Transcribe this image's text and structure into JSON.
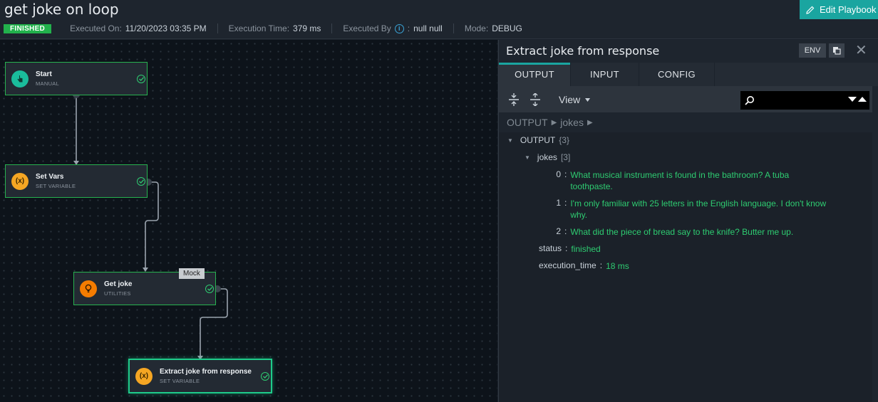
{
  "header": {
    "title": "get joke on loop",
    "edit_label": "Edit Playbook",
    "status": "FINISHED",
    "executed_on_label": "Executed On:",
    "executed_on": "11/20/2023 03:35 PM",
    "execution_time_label": "Execution Time:",
    "execution_time": "379 ms",
    "executed_by_label": "Executed By",
    "executed_by": "null null",
    "mode_label": "Mode:",
    "mode": "DEBUG"
  },
  "nodes": [
    {
      "name": "Start",
      "type": "MANUAL",
      "icon": "hand-pointer-icon"
    },
    {
      "name": "Set Vars",
      "type": "SET VARIABLE",
      "icon": "variable-icon"
    },
    {
      "name": "Get joke",
      "type": "UTILITIES",
      "icon": "lightbulb-icon",
      "tag": "Mock"
    },
    {
      "name": "Extract joke from response",
      "type": "SET VARIABLE",
      "icon": "variable-icon"
    }
  ],
  "variable_glyph": "(x)",
  "panel": {
    "title": "Extract joke from response",
    "env_label": "ENV",
    "close_glyph": "✕",
    "tabs": [
      "OUTPUT",
      "INPUT",
      "CONFIG"
    ],
    "view_label": "View",
    "breadcrumb": [
      "OUTPUT",
      "jokes"
    ],
    "breadcrumb_sep": "▶",
    "tree": {
      "root_label": "OUTPUT",
      "root_count": "{3}",
      "jokes_label": "jokes",
      "jokes_count": "[3]",
      "jokes": [
        {
          "index": "0",
          "line1": "What musical instrument is found in the bathroom? A tuba",
          "line2": "toothpaste."
        },
        {
          "index": "1",
          "line1": "I'm only familiar with 25 letters in the English language. I don't know",
          "line2": "why."
        },
        {
          "index": "2",
          "line1": "What did the piece of bread say to the knife? Butter me up.",
          "line2": ""
        }
      ],
      "status_label": "status",
      "status_value": "finished",
      "exec_time_label": "execution_time",
      "exec_time_value": "18 ms"
    }
  },
  "colors": {
    "accent": "#1aa5a0",
    "success": "#22b14c",
    "value_green": "#2ecc71",
    "teal_icon": "#1abc9c",
    "orange_icon": "#f5a623"
  }
}
